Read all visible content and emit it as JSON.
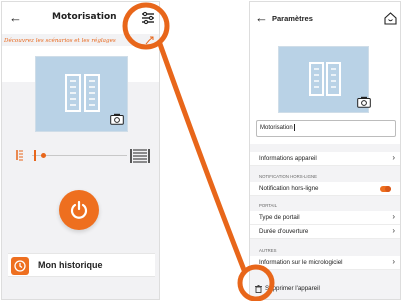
{
  "left_screen": {
    "back_icon": "arrow-left-icon",
    "title": "Motorisation",
    "settings_icon": "sliders-icon",
    "tip": "Découvrez les scénarios et les réglages",
    "camera_icon": "camera-icon",
    "power_icon": "power-icon",
    "history": {
      "icon": "history-clock-icon",
      "label": "Mon historique"
    },
    "accent_color": "#ee6f1f"
  },
  "right_screen": {
    "back_icon": "arrow-left-icon",
    "title": "Paramètres",
    "home_icon": "home-icon",
    "name_value": "Motorisation",
    "items": {
      "device_info": "Informations appareil",
      "offline_section": "NOTIFICATION HORS-LIGNE",
      "offline_label": "Notification hors-ligne",
      "portal_section": "PORTAIL",
      "portal_type": "Type de portail",
      "opening_duration": "Durée d'ouverture",
      "other_section": "AUTRES",
      "firmware_info": "Information sur le micrologiciel",
      "delete_device": "Supprimer l'appareil"
    },
    "offline_toggle_on": true,
    "chevron": "›"
  },
  "annotation": {
    "color": "#e8661a"
  }
}
